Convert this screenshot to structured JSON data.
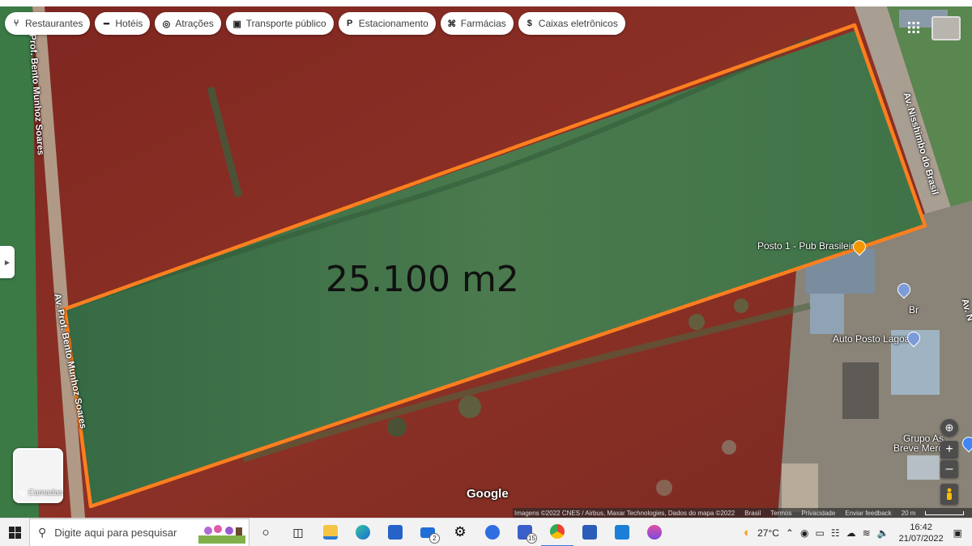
{
  "category_chips": [
    {
      "label": "Restaurantes",
      "icon": "fork-knife-icon",
      "glyph": "⑂"
    },
    {
      "label": "Hotéis",
      "icon": "bed-icon",
      "glyph": "━"
    },
    {
      "label": "Atrações",
      "icon": "camera-icon",
      "glyph": "◎"
    },
    {
      "label": "Transporte público",
      "icon": "bus-icon",
      "glyph": "▣"
    },
    {
      "label": "Estacionamento",
      "icon": "parking-icon",
      "glyph": "P"
    },
    {
      "label": "Farmácias",
      "icon": "pharmacy-icon",
      "glyph": "⌘"
    },
    {
      "label": "Caixas eletrônicos",
      "icon": "atm-icon",
      "glyph": "$"
    }
  ],
  "annotation": {
    "area_text": "25.100 m2",
    "outline_color": "#ff7f1e"
  },
  "roads": {
    "left_top": "Av. Prof. Bento Munhoz Soares",
    "left_bottom": "Av. Prof. Bento Munhoz Soares",
    "right": "Av. Nisshimbo do Brasil",
    "right_edge": "Av. N"
  },
  "pois": {
    "pub": "Posto 1 - Pub Brasileiro",
    "br_short": "Br",
    "auto_posto": "Auto Posto Lagoa",
    "grupo_line1": "Grupo As",
    "grupo_line2": "Breve Merc"
  },
  "watermark": "Google",
  "layers_label": "Camadas",
  "footer": {
    "imagery": "Imagens ©2022 CNES / Airbus, Maxar Technologies, Dados do mapa ©2022",
    "country": "Brasil",
    "terms": "Termos",
    "privacy": "Privacidade",
    "feedback": "Enviar feedback",
    "scale": "20 m"
  },
  "taskbar": {
    "search_placeholder": "Digite aqui para pesquisar",
    "mail_badge": "2",
    "teams_badge": "15",
    "weather": "27°C",
    "time": "16:42",
    "date": "21/07/2022"
  },
  "colors": {
    "soil": "#8c2b22",
    "grass": "#3f6a45",
    "outline": "#ff7f1e"
  }
}
